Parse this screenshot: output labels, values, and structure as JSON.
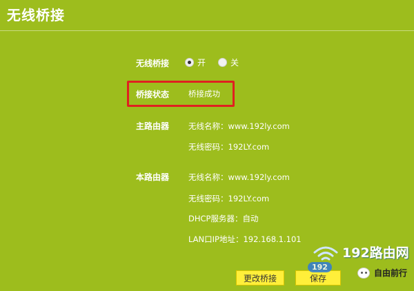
{
  "page": {
    "title": "无线桥接"
  },
  "bridge": {
    "label": "无线桥接",
    "options": [
      {
        "label": "开",
        "selected": true
      },
      {
        "label": "关",
        "selected": false
      }
    ]
  },
  "status": {
    "label": "桥接状态",
    "value": "桥接成功"
  },
  "main_router": {
    "label": "主路由器",
    "ssid_line": "无线名称：www.192ly.com",
    "password_line": "无线密码：192LY.com"
  },
  "local_router": {
    "label": "本路由器",
    "ssid_line": "无线名称：www.192ly.com",
    "password_line": "无线密码：192LY.com",
    "dhcp_line": "DHCP服务器：自动",
    "lan_line": "LAN口IP地址：192.168.1.101"
  },
  "buttons": {
    "change": "更改桥接",
    "save": "保存"
  },
  "watermark": {
    "brand": "192路由网",
    "pill": "192",
    "wechat_name": "自由前行"
  },
  "colors": {
    "background": "#9dbd1d",
    "highlight": "#e02020",
    "button": "#ffef3a"
  }
}
